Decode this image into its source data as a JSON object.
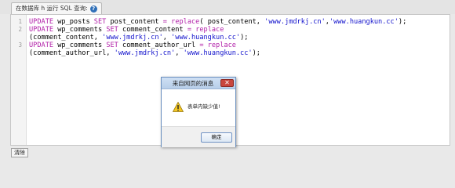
{
  "tab": {
    "label": "在数据库 h 运行 SQL 查询:"
  },
  "editor": {
    "line_numbers": [
      "1",
      "2",
      "3"
    ],
    "lines": [
      [
        {
          "t": "UPDATE",
          "c": "kw"
        },
        {
          "t": " wp_posts ",
          "c": "ident"
        },
        {
          "t": "SET",
          "c": "kw"
        },
        {
          "t": " post_content ",
          "c": "ident"
        },
        {
          "t": "=",
          "c": "op"
        },
        {
          "t": " ",
          "c": "ident"
        },
        {
          "t": "replace",
          "c": "kw"
        },
        {
          "t": "( post_content, ",
          "c": "ident"
        },
        {
          "t": "'www.jmdrkj.cn'",
          "c": "str"
        },
        {
          "t": ",",
          "c": "ident"
        },
        {
          "t": "'www.huangkun.cc'",
          "c": "str"
        },
        {
          "t": ");",
          "c": "ident"
        }
      ],
      [
        {
          "t": "UPDATE",
          "c": "kw"
        },
        {
          "t": " wp_comments ",
          "c": "ident"
        },
        {
          "t": "SET",
          "c": "kw"
        },
        {
          "t": " comment_content ",
          "c": "ident"
        },
        {
          "t": "=",
          "c": "op"
        },
        {
          "t": " ",
          "c": "ident"
        },
        {
          "t": "replace",
          "c": "kw"
        }
      ],
      [
        {
          "t": "(comment_content, ",
          "c": "ident"
        },
        {
          "t": "'www.jmdrkj.cn'",
          "c": "str"
        },
        {
          "t": ", ",
          "c": "ident"
        },
        {
          "t": "'www.huangkun.cc'",
          "c": "str"
        },
        {
          "t": ");",
          "c": "ident"
        }
      ],
      [
        {
          "t": "UPDATE",
          "c": "kw"
        },
        {
          "t": " wp_comments ",
          "c": "ident"
        },
        {
          "t": "SET",
          "c": "kw"
        },
        {
          "t": " comment_author_url ",
          "c": "ident"
        },
        {
          "t": "=",
          "c": "op"
        },
        {
          "t": " ",
          "c": "ident"
        },
        {
          "t": "replace",
          "c": "kw"
        }
      ],
      [
        {
          "t": "(comment_author_url, ",
          "c": "ident"
        },
        {
          "t": "'www.jmdrkj.cn'",
          "c": "str"
        },
        {
          "t": ", ",
          "c": "ident"
        },
        {
          "t": "'www.huangkun.cc'",
          "c": "str"
        },
        {
          "t": ");",
          "c": "ident"
        }
      ]
    ]
  },
  "bottom": {
    "clear_label": "清除"
  },
  "dialog": {
    "title": "来自网页的消息",
    "close_symbol": "✕",
    "icon": "warning-icon",
    "message": "表单内缺少值!",
    "ok_label": "确定"
  },
  "colors": {
    "keyword": "#b11fa8",
    "string": "#1111cc",
    "dialog_close": "#c9463d"
  }
}
